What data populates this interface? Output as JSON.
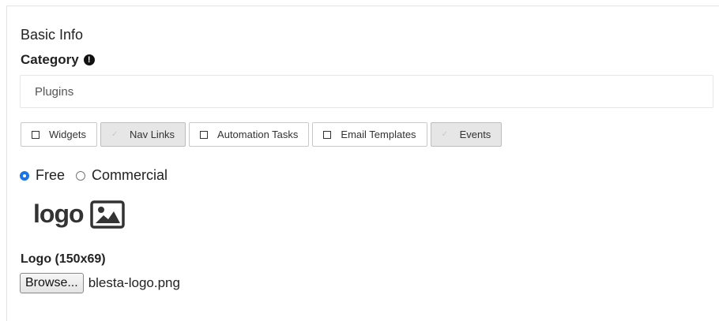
{
  "section": {
    "title": "Basic Info"
  },
  "category": {
    "label": "Category",
    "required_icon": "exclamation-circle-icon",
    "value": "Plugins"
  },
  "types": [
    {
      "label": "Widgets",
      "checked": false
    },
    {
      "label": "Nav Links",
      "checked": true
    },
    {
      "label": "Automation Tasks",
      "checked": false
    },
    {
      "label": "Email Templates",
      "checked": false
    },
    {
      "label": "Events",
      "checked": true
    }
  ],
  "license": {
    "options": [
      {
        "label": "Free",
        "selected": true
      },
      {
        "label": "Commercial",
        "selected": false
      }
    ]
  },
  "logo": {
    "text": "logo",
    "icon": "image-icon",
    "label": "Logo (150x69)",
    "browse_label": "Browse...",
    "file_name": "blesta-logo.png"
  },
  "colors": {
    "accent": "#1a73e8",
    "active_toggle_bg": "#e6e6e6"
  }
}
